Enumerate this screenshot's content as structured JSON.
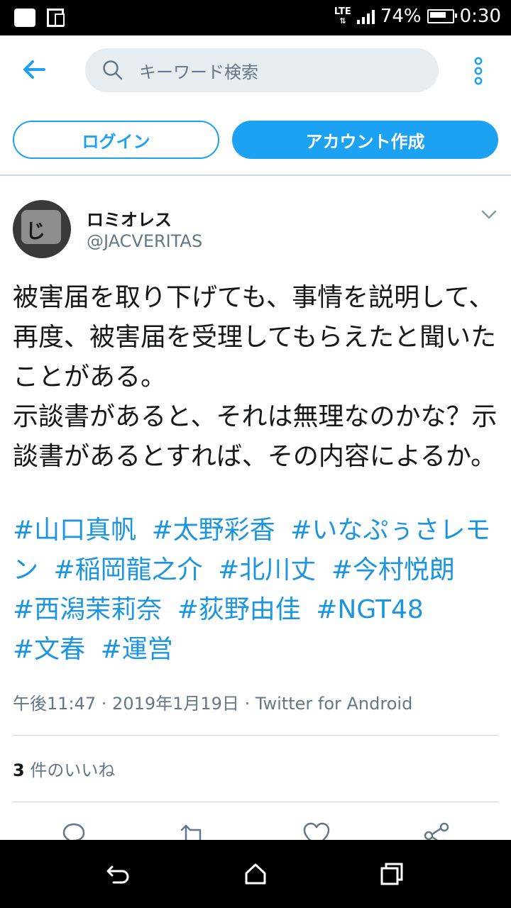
{
  "status_bar": {
    "network": "LTE",
    "battery": "74%",
    "time": "0:30"
  },
  "search": {
    "placeholder": "キーワード検索"
  },
  "auth": {
    "login_label": "ログイン",
    "signup_label": "アカウント作成"
  },
  "tweet": {
    "author_name": "ロミオレス",
    "author_handle": "@JACVERITAS",
    "text": "被害届を取り下げても、事情を説明して、再度、被害届を受理してもらえたと聞いたことがある。\n示談書があると、それは無理なのかな？示談書があるとすれば、その内容によるか。",
    "hashtags": [
      "#山口真帆",
      "#太野彩香",
      "#いなぷぅさレモン",
      "#稲岡龍之介",
      "#北川丈",
      "#今村悦朗",
      "#西潟茉莉奈",
      "#荻野由佳",
      "#NGT48",
      "#文春",
      "#運営"
    ],
    "timestamp": "午後11:47 · 2019年1月19日 · Twitter for Android",
    "likes_count": "3",
    "likes_label": " 件のいいね"
  },
  "colors": {
    "accent": "#1da1f2",
    "hashtag": "#1b95e0",
    "muted": "#657786"
  },
  "icons": [
    "back-arrow-icon",
    "search-icon",
    "more-vertical-icon",
    "chevron-down-icon",
    "reply-icon",
    "retweet-icon",
    "like-icon",
    "share-icon",
    "android-back-icon",
    "android-home-icon",
    "android-recents-icon"
  ]
}
